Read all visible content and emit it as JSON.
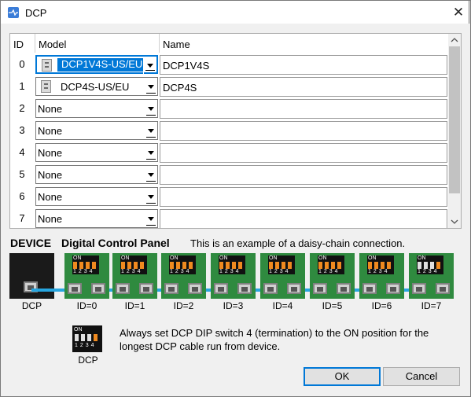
{
  "window": {
    "title": "DCP",
    "close_glyph": "✕"
  },
  "grid": {
    "headers": {
      "id": "ID",
      "model": "Model",
      "name": "Name"
    },
    "rows": [
      {
        "id": "0",
        "model": "DCP1V4S-US/EU",
        "name": "DCP1V4S"
      },
      {
        "id": "1",
        "model": "DCP4S-US/EU",
        "name": "DCP4S"
      },
      {
        "id": "2",
        "model": "None",
        "name": ""
      },
      {
        "id": "3",
        "model": "None",
        "name": ""
      },
      {
        "id": "4",
        "model": "None",
        "name": ""
      },
      {
        "id": "5",
        "model": "None",
        "name": ""
      },
      {
        "id": "6",
        "model": "None",
        "name": ""
      },
      {
        "id": "7",
        "model": "None",
        "name": ""
      }
    ]
  },
  "diagram": {
    "device_label": "DEVICE",
    "panel_label": "Digital Control Panel",
    "example_text": "This is an example of a daisy-chain connection.",
    "dcp_label": "DCP",
    "ids": [
      "ID=0",
      "ID=1",
      "ID=2",
      "ID=3",
      "ID=4",
      "ID=5",
      "ID=6",
      "ID=7"
    ],
    "dip_on": "ON",
    "dip_nums": "1234",
    "legend_label": "DCP",
    "note": "Always set DCP DIP switch 4 (termination) to the ON position for the longest DCP cable run from device.",
    "colors": {
      "panel": "#2f8a3f",
      "cable": "#27a6e0",
      "switch": "#f08a1f"
    }
  },
  "buttons": {
    "ok": "OK",
    "cancel": "Cancel"
  }
}
